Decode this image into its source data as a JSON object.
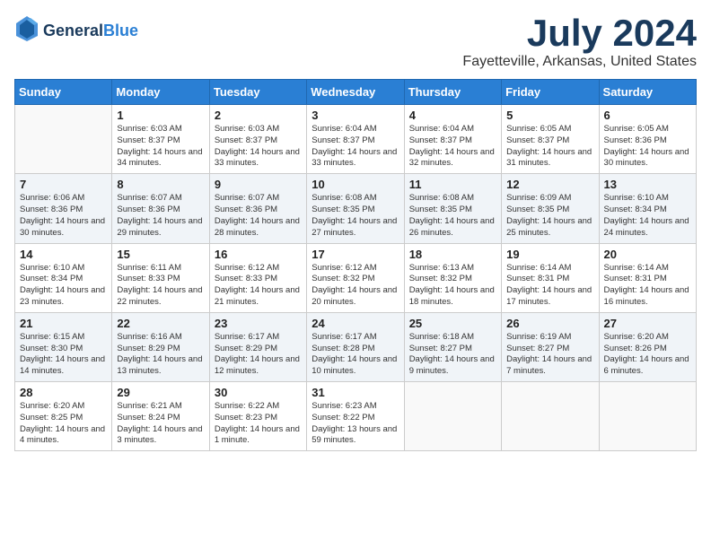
{
  "logo": {
    "general": "General",
    "blue": "Blue"
  },
  "header": {
    "month": "July 2024",
    "location": "Fayetteville, Arkansas, United States"
  },
  "weekdays": [
    "Sunday",
    "Monday",
    "Tuesday",
    "Wednesday",
    "Thursday",
    "Friday",
    "Saturday"
  ],
  "weeks": [
    [
      {
        "day": "",
        "sunrise": "",
        "sunset": "",
        "daylight": ""
      },
      {
        "day": "1",
        "sunrise": "Sunrise: 6:03 AM",
        "sunset": "Sunset: 8:37 PM",
        "daylight": "Daylight: 14 hours and 34 minutes."
      },
      {
        "day": "2",
        "sunrise": "Sunrise: 6:03 AM",
        "sunset": "Sunset: 8:37 PM",
        "daylight": "Daylight: 14 hours and 33 minutes."
      },
      {
        "day": "3",
        "sunrise": "Sunrise: 6:04 AM",
        "sunset": "Sunset: 8:37 PM",
        "daylight": "Daylight: 14 hours and 33 minutes."
      },
      {
        "day": "4",
        "sunrise": "Sunrise: 6:04 AM",
        "sunset": "Sunset: 8:37 PM",
        "daylight": "Daylight: 14 hours and 32 minutes."
      },
      {
        "day": "5",
        "sunrise": "Sunrise: 6:05 AM",
        "sunset": "Sunset: 8:37 PM",
        "daylight": "Daylight: 14 hours and 31 minutes."
      },
      {
        "day": "6",
        "sunrise": "Sunrise: 6:05 AM",
        "sunset": "Sunset: 8:36 PM",
        "daylight": "Daylight: 14 hours and 30 minutes."
      }
    ],
    [
      {
        "day": "7",
        "sunrise": "Sunrise: 6:06 AM",
        "sunset": "Sunset: 8:36 PM",
        "daylight": "Daylight: 14 hours and 30 minutes."
      },
      {
        "day": "8",
        "sunrise": "Sunrise: 6:07 AM",
        "sunset": "Sunset: 8:36 PM",
        "daylight": "Daylight: 14 hours and 29 minutes."
      },
      {
        "day": "9",
        "sunrise": "Sunrise: 6:07 AM",
        "sunset": "Sunset: 8:36 PM",
        "daylight": "Daylight: 14 hours and 28 minutes."
      },
      {
        "day": "10",
        "sunrise": "Sunrise: 6:08 AM",
        "sunset": "Sunset: 8:35 PM",
        "daylight": "Daylight: 14 hours and 27 minutes."
      },
      {
        "day": "11",
        "sunrise": "Sunrise: 6:08 AM",
        "sunset": "Sunset: 8:35 PM",
        "daylight": "Daylight: 14 hours and 26 minutes."
      },
      {
        "day": "12",
        "sunrise": "Sunrise: 6:09 AM",
        "sunset": "Sunset: 8:35 PM",
        "daylight": "Daylight: 14 hours and 25 minutes."
      },
      {
        "day": "13",
        "sunrise": "Sunrise: 6:10 AM",
        "sunset": "Sunset: 8:34 PM",
        "daylight": "Daylight: 14 hours and 24 minutes."
      }
    ],
    [
      {
        "day": "14",
        "sunrise": "Sunrise: 6:10 AM",
        "sunset": "Sunset: 8:34 PM",
        "daylight": "Daylight: 14 hours and 23 minutes."
      },
      {
        "day": "15",
        "sunrise": "Sunrise: 6:11 AM",
        "sunset": "Sunset: 8:33 PM",
        "daylight": "Daylight: 14 hours and 22 minutes."
      },
      {
        "day": "16",
        "sunrise": "Sunrise: 6:12 AM",
        "sunset": "Sunset: 8:33 PM",
        "daylight": "Daylight: 14 hours and 21 minutes."
      },
      {
        "day": "17",
        "sunrise": "Sunrise: 6:12 AM",
        "sunset": "Sunset: 8:32 PM",
        "daylight": "Daylight: 14 hours and 20 minutes."
      },
      {
        "day": "18",
        "sunrise": "Sunrise: 6:13 AM",
        "sunset": "Sunset: 8:32 PM",
        "daylight": "Daylight: 14 hours and 18 minutes."
      },
      {
        "day": "19",
        "sunrise": "Sunrise: 6:14 AM",
        "sunset": "Sunset: 8:31 PM",
        "daylight": "Daylight: 14 hours and 17 minutes."
      },
      {
        "day": "20",
        "sunrise": "Sunrise: 6:14 AM",
        "sunset": "Sunset: 8:31 PM",
        "daylight": "Daylight: 14 hours and 16 minutes."
      }
    ],
    [
      {
        "day": "21",
        "sunrise": "Sunrise: 6:15 AM",
        "sunset": "Sunset: 8:30 PM",
        "daylight": "Daylight: 14 hours and 14 minutes."
      },
      {
        "day": "22",
        "sunrise": "Sunrise: 6:16 AM",
        "sunset": "Sunset: 8:29 PM",
        "daylight": "Daylight: 14 hours and 13 minutes."
      },
      {
        "day": "23",
        "sunrise": "Sunrise: 6:17 AM",
        "sunset": "Sunset: 8:29 PM",
        "daylight": "Daylight: 14 hours and 12 minutes."
      },
      {
        "day": "24",
        "sunrise": "Sunrise: 6:17 AM",
        "sunset": "Sunset: 8:28 PM",
        "daylight": "Daylight: 14 hours and 10 minutes."
      },
      {
        "day": "25",
        "sunrise": "Sunrise: 6:18 AM",
        "sunset": "Sunset: 8:27 PM",
        "daylight": "Daylight: 14 hours and 9 minutes."
      },
      {
        "day": "26",
        "sunrise": "Sunrise: 6:19 AM",
        "sunset": "Sunset: 8:27 PM",
        "daylight": "Daylight: 14 hours and 7 minutes."
      },
      {
        "day": "27",
        "sunrise": "Sunrise: 6:20 AM",
        "sunset": "Sunset: 8:26 PM",
        "daylight": "Daylight: 14 hours and 6 minutes."
      }
    ],
    [
      {
        "day": "28",
        "sunrise": "Sunrise: 6:20 AM",
        "sunset": "Sunset: 8:25 PM",
        "daylight": "Daylight: 14 hours and 4 minutes."
      },
      {
        "day": "29",
        "sunrise": "Sunrise: 6:21 AM",
        "sunset": "Sunset: 8:24 PM",
        "daylight": "Daylight: 14 hours and 3 minutes."
      },
      {
        "day": "30",
        "sunrise": "Sunrise: 6:22 AM",
        "sunset": "Sunset: 8:23 PM",
        "daylight": "Daylight: 14 hours and 1 minute."
      },
      {
        "day": "31",
        "sunrise": "Sunrise: 6:23 AM",
        "sunset": "Sunset: 8:22 PM",
        "daylight": "Daylight: 13 hours and 59 minutes."
      },
      {
        "day": "",
        "sunrise": "",
        "sunset": "",
        "daylight": ""
      },
      {
        "day": "",
        "sunrise": "",
        "sunset": "",
        "daylight": ""
      },
      {
        "day": "",
        "sunrise": "",
        "sunset": "",
        "daylight": ""
      }
    ]
  ]
}
